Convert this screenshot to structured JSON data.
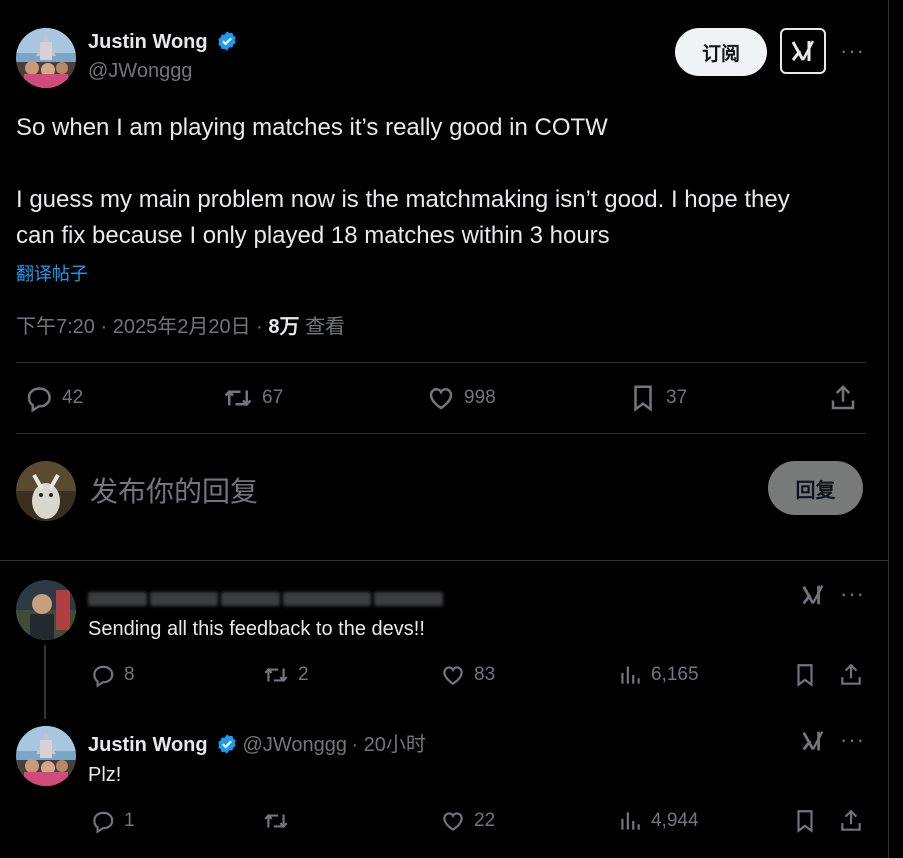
{
  "post": {
    "author_name": "Justin Wong",
    "author_handle": "@JWonggg",
    "subscribe_label": "订阅",
    "text_line1": "So when I am playing matches it’s really good in COTW",
    "text_line2": "I guess my main problem now is the matchmaking isn’t good.  I hope they",
    "text_line3": "can fix because I only played 18 matches within 3 hours",
    "translate_label": "翻译帖子",
    "time": "下午7:20",
    "date": "2025年2月20日",
    "views_count": "8万",
    "views_label": "查看",
    "replies": "42",
    "reposts": "67",
    "likes": "998",
    "bookmarks": "37"
  },
  "composer": {
    "placeholder": "发布你的回复",
    "reply_button": "回复"
  },
  "replies": [
    {
      "text": "Sending all this feedback to the devs!!",
      "replies": "8",
      "reposts": "2",
      "likes": "83",
      "views": "6,165"
    },
    {
      "author_name": "Justin Wong",
      "author_handle": "@JWonggg",
      "time": "· 20小时",
      "text": "Plz!",
      "replies": "1",
      "reposts": "",
      "likes": "22",
      "views": "4,944"
    }
  ],
  "icons": {
    "verified": "verified-badge-icon",
    "grok": "grok-icon",
    "more": "more-icon",
    "reply": "reply-icon",
    "repost": "repost-icon",
    "like": "like-icon",
    "bookmark": "bookmark-icon",
    "share": "share-icon",
    "views": "views-icon"
  },
  "colors": {
    "background": "#000000",
    "text": "#e7e9ea",
    "muted": "#71767b",
    "link": "#1d9bf0",
    "verified": "#1d9bf0"
  }
}
